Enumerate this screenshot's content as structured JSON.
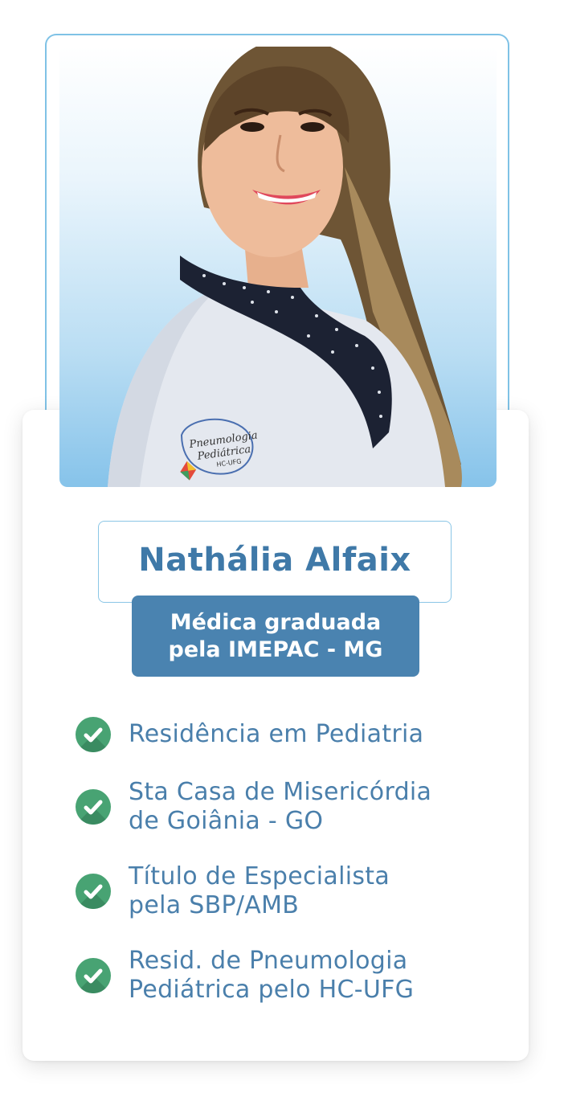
{
  "profile": {
    "name": "Nathália Alfaix",
    "subtitle_line1": "Médica graduada",
    "subtitle_line2": "pela IMEPAC - MG",
    "badge_text": "Pneumologia Pediátrica HC-UFG"
  },
  "credentials": [
    {
      "line1": "Residência em Pediatria",
      "line2": ""
    },
    {
      "line1": "Sta Casa de Misericórdia",
      "line2": "de Goiânia - GO"
    },
    {
      "line1": "Título de Especialista",
      "line2": "pela SBP/AMB"
    },
    {
      "line1": "Resid. de Pneumologia",
      "line2": "Pediátrica pelo HC-UFG"
    }
  ],
  "colors": {
    "accent": "#4a83b0",
    "name": "#3f79a8",
    "check": "#48a373",
    "frame": "#7fc2e6"
  },
  "icons": {
    "check": "check-circle-icon"
  }
}
